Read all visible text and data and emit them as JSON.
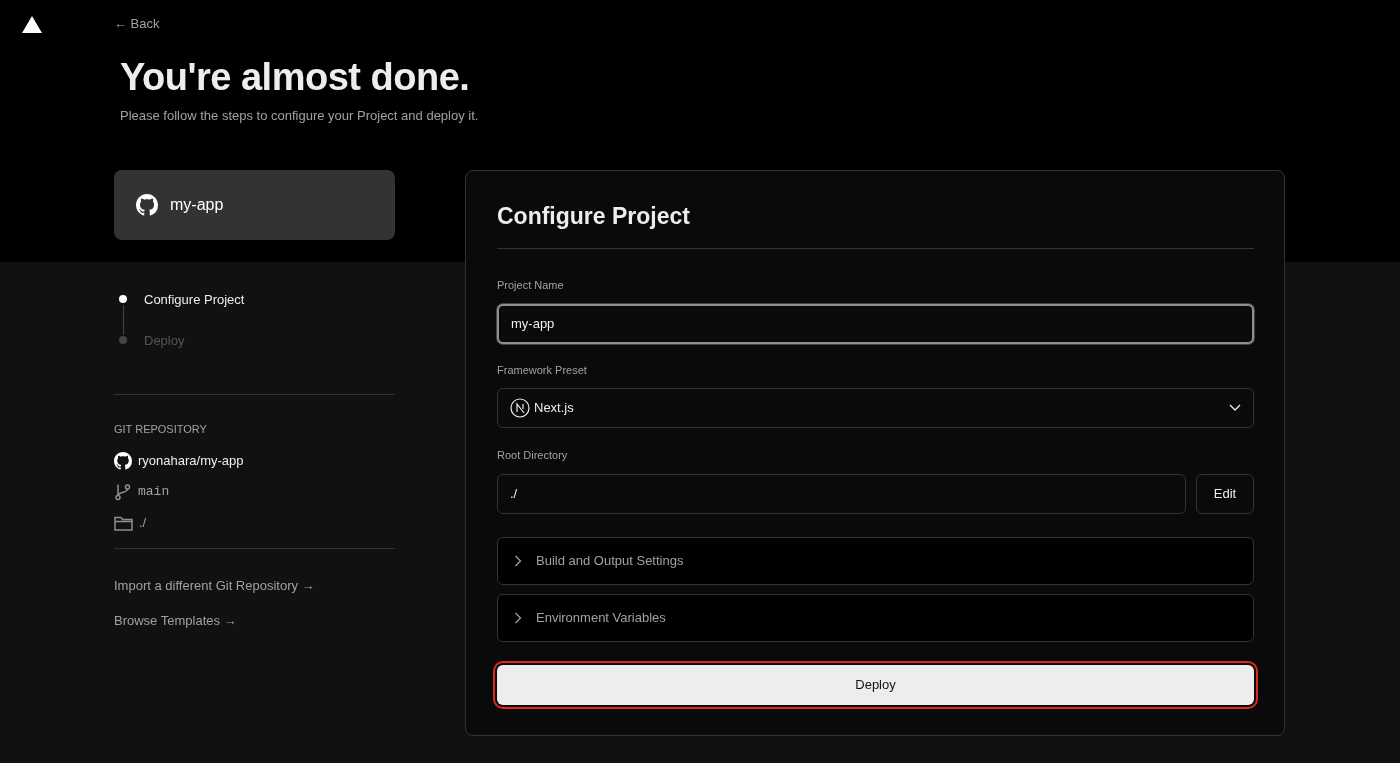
{
  "header": {
    "back_link": "← Back"
  },
  "title": "You're almost done.",
  "subtitle": "Please follow the steps to configure your Project and deploy it.",
  "repo_card": {
    "name": "my-app"
  },
  "steps": [
    {
      "label": "Configure Project",
      "selected": true
    },
    {
      "label": "Deploy",
      "selected": false
    }
  ],
  "git_repository": {
    "heading": "GIT REPOSITORY",
    "repo": "ryonahara/my-app",
    "branch": "main",
    "directory": "./"
  },
  "links": [
    "Import a different Git Repository →",
    "Browse Templates →"
  ],
  "configure": {
    "title": "Configure Project",
    "project_name": {
      "label": "Project Name",
      "value": "my-app",
      "focused": true
    },
    "framework_preset": {
      "label": "Framework Preset",
      "value": "Next.js"
    },
    "root_directory": {
      "label": "Root Directory",
      "value": "./",
      "button": "Edit"
    },
    "sections": [
      {
        "label": "Build and Output Settings",
        "expanded": false
      },
      {
        "label": "Environment Variables",
        "expanded": false
      }
    ],
    "deploy_button": {
      "label": "Deploy",
      "highlighted": true
    }
  }
}
